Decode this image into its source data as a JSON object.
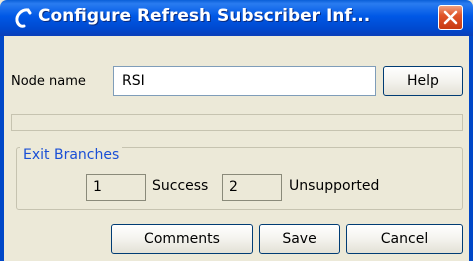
{
  "window": {
    "title": "Configure Refresh Subscriber Inf...",
    "titlebar_color": "#0058e6",
    "close_color": "#e0552a"
  },
  "node": {
    "label": "Node name",
    "value": "RSI",
    "help_label": "Help"
  },
  "exit_branches": {
    "title": "Exit Branches",
    "title_color": "#1a4fd6",
    "branches": [
      {
        "number": "1",
        "label": "Success"
      },
      {
        "number": "2",
        "label": "Unsupported"
      }
    ]
  },
  "buttons": {
    "comments": "Comments",
    "save": "Save",
    "cancel": "Cancel"
  }
}
